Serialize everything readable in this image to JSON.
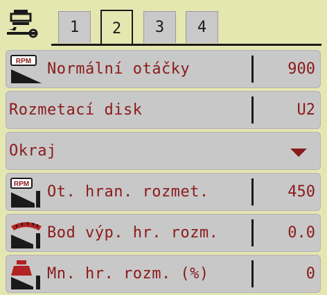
{
  "tabs": [
    {
      "label": "1",
      "active": false
    },
    {
      "label": "2",
      "active": true
    },
    {
      "label": "3",
      "active": false
    },
    {
      "label": "4",
      "active": false
    }
  ],
  "rows": [
    {
      "icon": "rpm-slope-icon",
      "icon_text": "RPM",
      "label": "Normální otáčky",
      "value": "900"
    },
    {
      "icon": "",
      "label": "Rozmetací disk",
      "value": "U2"
    },
    {
      "icon": "",
      "label": "Okraj",
      "value": "",
      "dropdown": true
    },
    {
      "icon": "rpm-border-icon",
      "icon_text": "RPM",
      "label": "Ot. hran. rozmet.",
      "value": "450"
    },
    {
      "icon": "border-point-icon",
      "label": "Bod výp. hr. rozm.",
      "value": "0.0"
    },
    {
      "icon": "border-quantity-weight-icon",
      "label": "Mn. hr. rozm. (%)",
      "value": "0"
    }
  ],
  "colors": {
    "background": "#e5e7b1",
    "row": "#c8c8c8",
    "text": "#8b1a1a",
    "separator": "#1a1a1a"
  }
}
